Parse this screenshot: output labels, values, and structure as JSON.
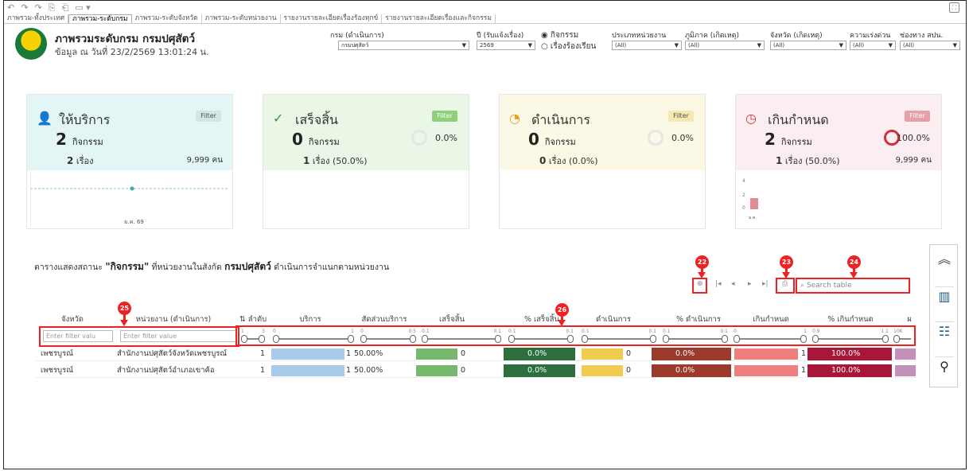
{
  "toolbar": {
    "undo": "↶",
    "redo1": "↷",
    "redo2": "↷",
    "icon1": "⎘",
    "icon2": "⎗",
    "icon3": "▭ ▾"
  },
  "tabs": [
    "ภาพรวม-ทั้งประเทศ",
    "ภาพรวม-ระดับกรม",
    "ภาพรวม-ระดับจังหวัด",
    "ภาพรวม-ระดับหน่วยงาน",
    "รายงานรายละเอียดเรื่องร้องทุกข์",
    "รายงานรายละเอียดเรื่องและกิจกรรม"
  ],
  "header": {
    "title": "ภาพรวมระดับกรม กรมปศุสัตว์",
    "subtitle": "ข้อมูล ณ วันที่ 23/2/2569 13:01:24 น."
  },
  "filters": {
    "dept_label": "กรม (ดำเนินการ)",
    "dept_value": "กรมปศุสัตว์",
    "year_label": "ปี (รับแจ้งเรื่อง)",
    "year_value": "2569",
    "radio1": "◉ กิจกรรม",
    "radio2": "○ เรื่องร้องเรียน",
    "unit_type_label": "ประเภทหน่วยงาน",
    "unit_type_value": "(All)",
    "region_label": "ภูมิภาค (เกิดเหตุ)",
    "region_value": "(All)",
    "province_label": "จังหวัด (เกิดเหตุ)",
    "province_value": "(All)",
    "urgency_label": "ความเร่งด่วน",
    "urgency_value": "(All)",
    "channel_label": "ช่องทาง สปน.",
    "channel_value": "(All)"
  },
  "cards": [
    {
      "title": "ให้บริการ",
      "filter": "Filter",
      "count": "2",
      "count_unit": "กิจกรรม",
      "sub_count": "2",
      "sub_unit": "เรื่อง",
      "sub_pct": "",
      "pct": "",
      "people": "9,999 คน",
      "chart_label": "ม.ค. 69"
    },
    {
      "title": "เสร็จสิ้น",
      "filter": "Filter",
      "count": "0",
      "count_unit": "กิจกรรม",
      "sub_count": "1",
      "sub_unit": "เรื่อง",
      "sub_pct": "(50.0%)",
      "pct": "0.0%"
    },
    {
      "title": "ดำเนินการ",
      "filter": "Filter",
      "count": "0",
      "count_unit": "กิจกรรม",
      "sub_count": "0",
      "sub_unit": "เรื่อง",
      "sub_pct": "(0.0%)",
      "pct": "0.0%"
    },
    {
      "title": "เกินกำหนด",
      "filter": "Filter",
      "count": "2",
      "count_unit": "กิจกรรม",
      "sub_count": "1",
      "sub_unit": "เรื่อง",
      "sub_pct": "(50.0%)",
      "pct": "100.0%",
      "people": "9,999 คน",
      "chart_label": "ม.ค.",
      "chart_ticks": [
        "4",
        "2",
        "0"
      ]
    }
  ],
  "table": {
    "title_prefix": "ตารางแสดงสถานะ ",
    "title_bold1": "\"กิจกรรม\"",
    "title_mid": " ที่หน่วยงานในสังกัด ",
    "title_bold2": "กรมปศุสัตว์",
    "title_suffix": " ดำเนินการจำแนกตามหน่วยงาน",
    "search_placeholder": "Search table",
    "filter_placeholder1": "Enter filter valu",
    "filter_placeholder2": "Enter filter value",
    "headers": [
      "จังหวัด",
      "หน่วยงาน (ดำเนินการ)",
      "⇅ ลำดับ",
      "บริการ",
      "สัดส่วนบริการ",
      "เสร็จสิ้น",
      "% เสร็จสิ้น",
      "ดำเนินการ",
      "% ดำเนินการ",
      "เกินกำหนด",
      "% เกินกำหนด",
      "ผ"
    ],
    "slider_ranges": [
      [
        "1",
        "3"
      ],
      [
        "0",
        "1"
      ],
      [
        "0",
        "0.5"
      ],
      [
        "0.1",
        "0.1"
      ],
      [
        "0.1",
        "0.1"
      ],
      [
        "0.1",
        "0.1"
      ],
      [
        "0.1",
        "0.1"
      ],
      [
        "0",
        "1"
      ],
      [
        "0.9",
        "1.1"
      ],
      [
        "10K",
        ""
      ]
    ],
    "rows": [
      {
        "province": "เพชรบูรณ์",
        "unit": "สำนักงานปศุสัตว์จังหวัดเพชรบูรณ์",
        "order": "1",
        "service": "1",
        "service_pct": "50.00%",
        "done": "0",
        "done_pct": "0.0%",
        "inprog": "0",
        "inprog_pct": "0.0%",
        "overdue": "1",
        "overdue_pct": "100.0%"
      },
      {
        "province": "เพชรบูรณ์",
        "unit": "สำนักงานปศุสัตว์อำเภอเขาค้อ",
        "order": "1",
        "service": "1",
        "service_pct": "50.00%",
        "done": "0",
        "done_pct": "0.0%",
        "inprog": "0",
        "inprog_pct": "0.0%",
        "overdue": "1",
        "overdue_pct": "100.0%"
      }
    ]
  },
  "annotations": [
    "22",
    "23",
    "24",
    "25",
    "26"
  ],
  "side_panel": {
    "up": "︽",
    "chart": "▥",
    "list": "☷",
    "map": "⚲"
  },
  "colors": {
    "card1_bg": "#e3f5f4",
    "card2_bg": "#eaf6e6",
    "card3_bg": "#fcf8e6",
    "card4_bg": "#fbeef0",
    "green_btn": "#8fcf7a",
    "red_btn": "#e8a0a8",
    "blue_bar": "#a7cbe8",
    "green_bar": "#76b96e",
    "yellow_bar": "#efcb50",
    "salmon_bar": "#ef7f7f",
    "dark_green": "#2c6e3e",
    "dark_red": "#9b3a2a",
    "crimson": "#a8173a",
    "annot": "#e22222"
  }
}
